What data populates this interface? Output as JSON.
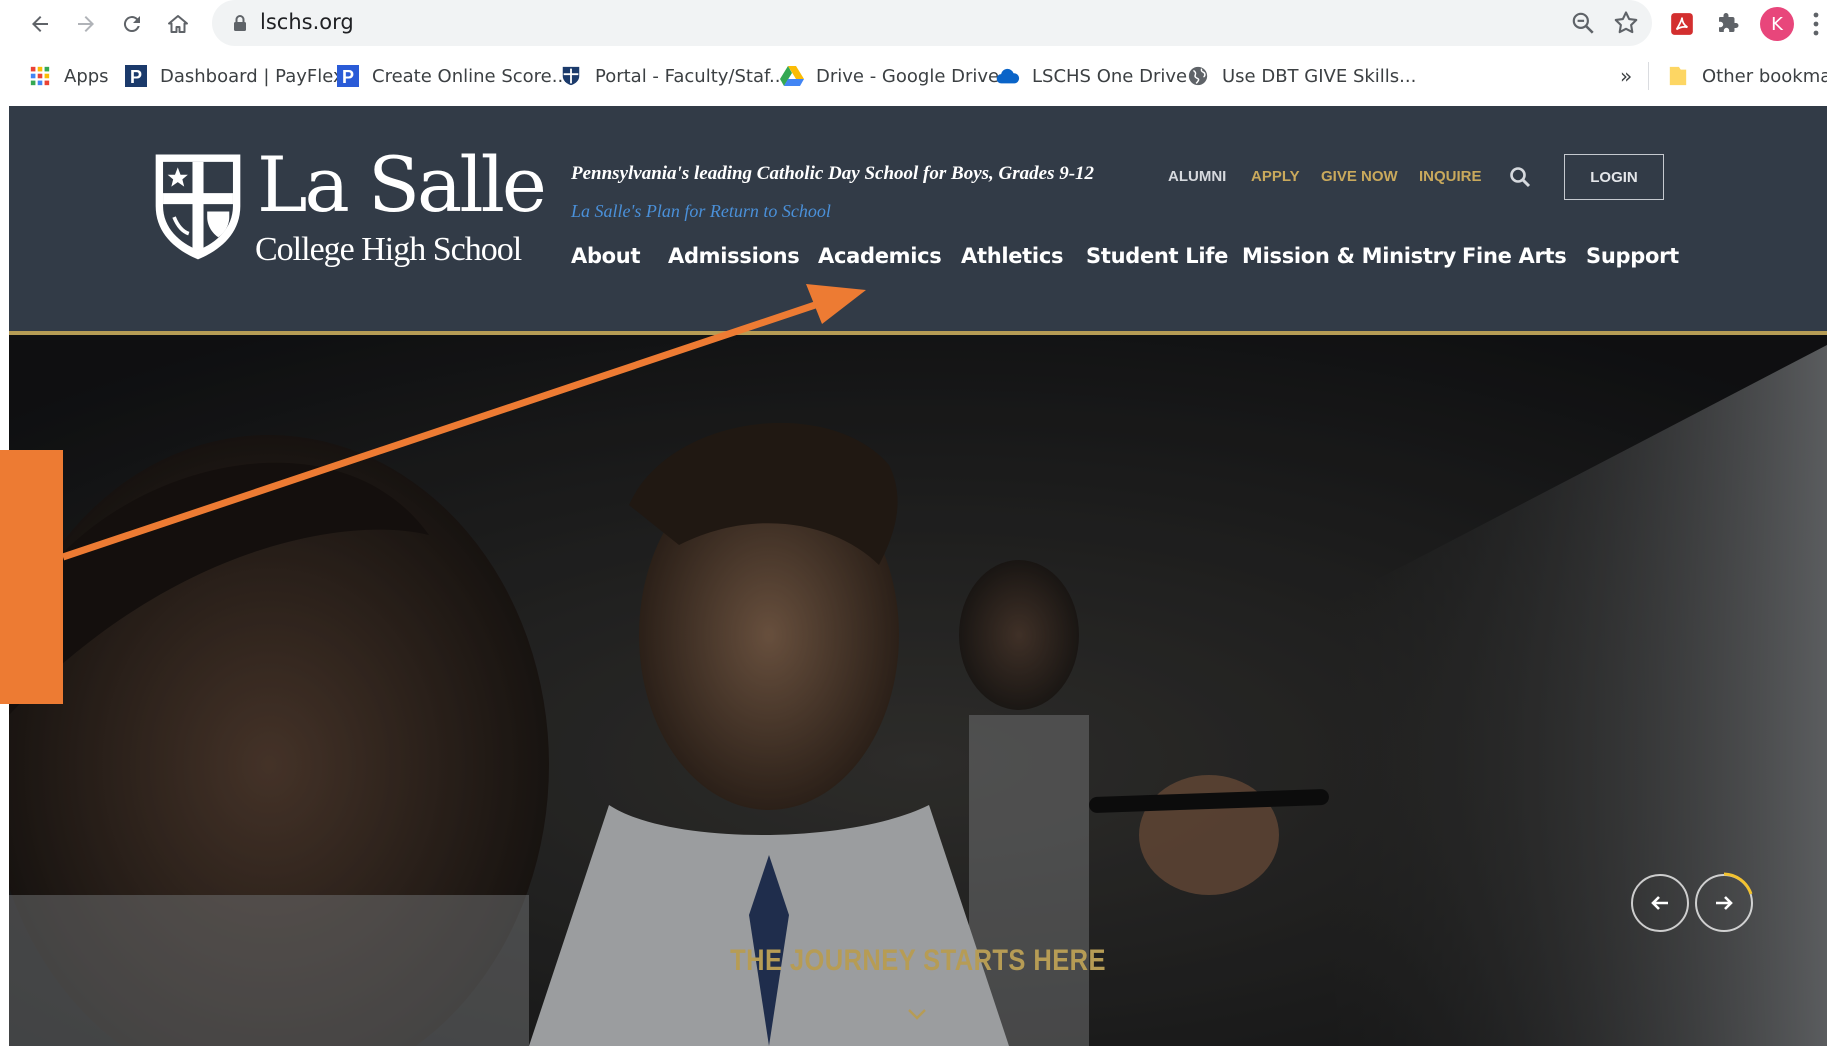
{
  "browser": {
    "url": "lschs.org",
    "profile_initial": "K",
    "bookmarks": [
      {
        "label": "Apps"
      },
      {
        "label": "Dashboard | PayFlex"
      },
      {
        "label": "Create Online Score..."
      },
      {
        "label": "Portal - Faculty/Staf..."
      },
      {
        "label": "Drive - Google Drive"
      },
      {
        "label": "LSCHS One Drive"
      },
      {
        "label": "Use DBT GIVE Skills..."
      }
    ],
    "overflow": "»",
    "other_bookmarks": "Other bookmark"
  },
  "site": {
    "logo": {
      "main": "La Salle",
      "sub": "College High School"
    },
    "tagline": "Pennsylvania's leading Catholic Day School for Boys, Grades 9-12",
    "return_link": "La Salle's Plan for Return to School",
    "utility": {
      "alumni": "ALUMNI",
      "apply": "APPLY",
      "give_now": "GIVE NOW",
      "inquire": "INQUIRE",
      "login": "LOGIN"
    },
    "nav": [
      "About",
      "Admissions",
      "Academics",
      "Athletics",
      "Student Life",
      "Mission & Ministry",
      "Fine Arts",
      "Support"
    ],
    "hero": {
      "headline": "THE JOURNEY STARTS HERE"
    }
  },
  "colors": {
    "header_bg": "#323b47",
    "gold": "#b69c55",
    "link_blue": "#4a90d9",
    "annotation_orange": "#ed7b33"
  }
}
